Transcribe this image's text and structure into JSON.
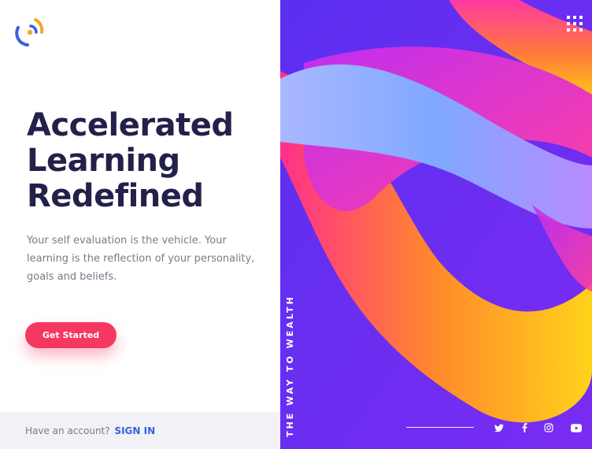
{
  "hero": {
    "headline": [
      "Accelerated",
      "Learning",
      "Redefined"
    ],
    "description": "Your self evaluation is the vehicle. Your learning is the reflection of your personality, goals and beliefs.",
    "cta_label": "Get Started"
  },
  "footer": {
    "account_prompt": "Have an account?",
    "signin_label": "SIGN IN"
  },
  "side": {
    "tagline": "THE WAY TO WEALTH"
  },
  "social": [
    "twitter-icon",
    "facebook-icon",
    "instagram-icon",
    "youtube-icon"
  ],
  "colors": {
    "accent": "#f5385f",
    "heading": "#23214a",
    "link": "#3a5fd9",
    "panel_bg": "#6b2cf0"
  }
}
